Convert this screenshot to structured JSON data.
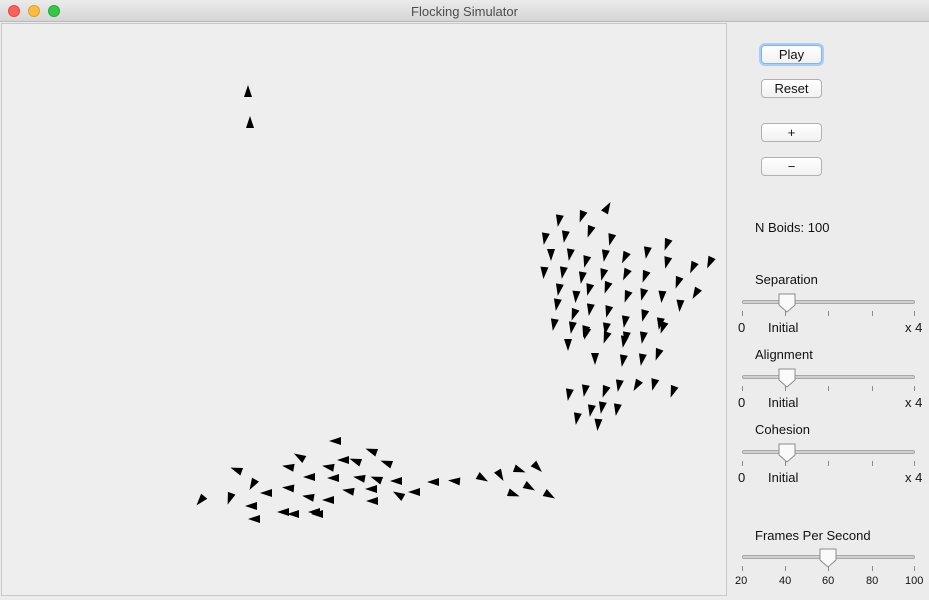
{
  "window": {
    "title": "Flocking Simulator"
  },
  "controls": {
    "play_label": "Play",
    "reset_label": "Reset",
    "add_label": "+",
    "remove_label": "−",
    "nboids_text": "N Boids: 100",
    "sliders": [
      {
        "name": "Separation",
        "min_label": "0",
        "mid_label": "Initial",
        "max_label": "x 4",
        "value_fraction": 0.25
      },
      {
        "name": "Alignment",
        "min_label": "0",
        "mid_label": "Initial",
        "max_label": "x 4",
        "value_fraction": 0.25
      },
      {
        "name": "Cohesion",
        "min_label": "0",
        "mid_label": "Initial",
        "max_label": "x 4",
        "value_fraction": 0.25
      }
    ],
    "fps": {
      "name": "Frames Per Second",
      "ticks": [
        "20",
        "40",
        "60",
        "80",
        "100"
      ],
      "value": 60
    }
  },
  "boid_count": 100
}
